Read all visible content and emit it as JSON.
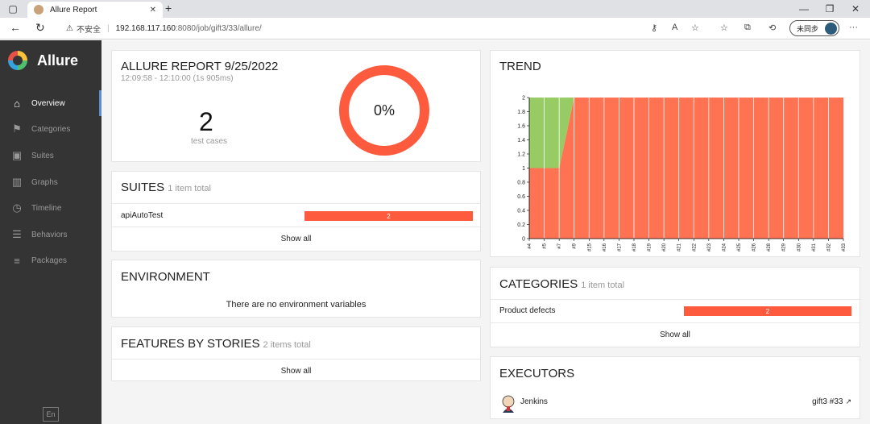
{
  "browser": {
    "tab_title": "Allure Report",
    "tab_close": "✕",
    "new_tab": "+",
    "insecure_label": "不安全",
    "url_host": "192.168.117.160",
    "url_rest": ":8080/job/gift3/33/allure/",
    "sync_label": "未同步",
    "more": "···"
  },
  "sidebar": {
    "brand": "Allure",
    "items": [
      {
        "label": "Overview",
        "icon": "home-icon"
      },
      {
        "label": "Categories",
        "icon": "flag-icon"
      },
      {
        "label": "Suites",
        "icon": "briefcase-icon"
      },
      {
        "label": "Graphs",
        "icon": "bar-chart-icon"
      },
      {
        "label": "Timeline",
        "icon": "clock-icon"
      },
      {
        "label": "Behaviors",
        "icon": "list-icon"
      },
      {
        "label": "Packages",
        "icon": "align-left-icon"
      }
    ],
    "language": "En"
  },
  "report": {
    "title": "ALLURE REPORT 9/25/2022",
    "time_range": "12:09:58 - 12:10:00 (1s 905ms)",
    "test_count": "2",
    "test_count_label": "test cases",
    "success_rate": "0%",
    "success_fraction": 0
  },
  "suites": {
    "title": "SUITES",
    "subtitle": "1 item total",
    "rows": [
      {
        "name": "apiAutoTest",
        "value": "2"
      }
    ],
    "show_all": "Show all"
  },
  "environment": {
    "title": "ENVIRONMENT",
    "message": "There are no environment variables"
  },
  "features": {
    "title": "FEATURES BY STORIES",
    "subtitle": "2 items total",
    "show_all": "Show all"
  },
  "trend": {
    "title": "TREND"
  },
  "categories": {
    "title": "CATEGORIES",
    "subtitle": "1 item total",
    "rows": [
      {
        "name": "Product defects",
        "value": "2"
      }
    ],
    "show_all": "Show all"
  },
  "executors": {
    "title": "EXECUTORS",
    "name": "Jenkins",
    "build": "gift3 #33"
  },
  "colors": {
    "failed": "#fd5a3e",
    "passed": "#97cc64",
    "trend_failed": "#ff7353",
    "sidebar": "#343434"
  },
  "chart_data": {
    "type": "area",
    "x": [
      "#4",
      "#5",
      "#7",
      "#9",
      "#15",
      "#16",
      "#17",
      "#18",
      "#19",
      "#20",
      "#21",
      "#22",
      "#23",
      "#24",
      "#25",
      "#26",
      "#28",
      "#29",
      "#30",
      "#31",
      "#32",
      "#33"
    ],
    "y_ticks": [
      "0",
      "0.2",
      "0.4",
      "0.6",
      "0.8",
      "1",
      "1.2",
      "1.4",
      "1.6",
      "1.8",
      "2"
    ],
    "ylim": [
      0,
      2
    ],
    "series": [
      {
        "name": "failed",
        "values": [
          1,
          1,
          1,
          2,
          2,
          2,
          2,
          2,
          2,
          2,
          2,
          2,
          2,
          2,
          2,
          2,
          2,
          2,
          2,
          2,
          2,
          2
        ]
      },
      {
        "name": "passed",
        "values": [
          1,
          1,
          1,
          0,
          0,
          0,
          0,
          0,
          0,
          0,
          0,
          0,
          0,
          0,
          0,
          0,
          0,
          0,
          0,
          0,
          0,
          0
        ]
      }
    ]
  }
}
